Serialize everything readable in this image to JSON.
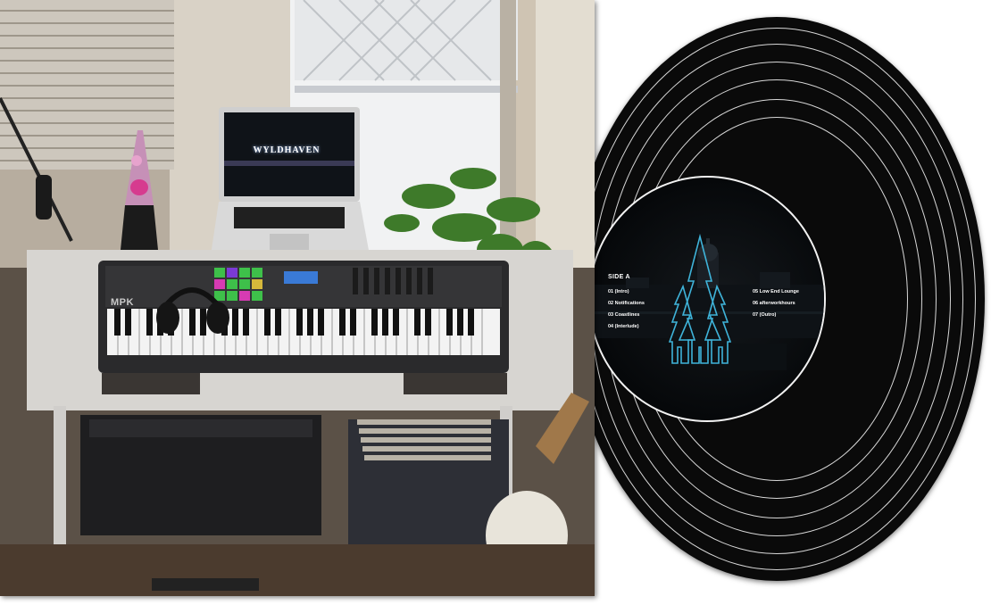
{
  "album": {
    "side_label": "SIDE A",
    "tracks_left": [
      "01 (Intro)",
      "02 Notifications",
      "03 Coastlines",
      "04 (Interlude)"
    ],
    "tracks_right": [
      "05 Low End Lounge",
      "06 afterworkhours",
      "07 (Outro)"
    ],
    "logo_icon": "pine-trees-icon"
  },
  "photo": {
    "screen_text": "WYLDHAVEN",
    "keyboard_brand": "MPK"
  },
  "colors": {
    "vinyl": "#0a0a0a",
    "groove": "#d8d8d8",
    "logo_outline": "#3fb3d9",
    "label_text": "#ffffff"
  }
}
